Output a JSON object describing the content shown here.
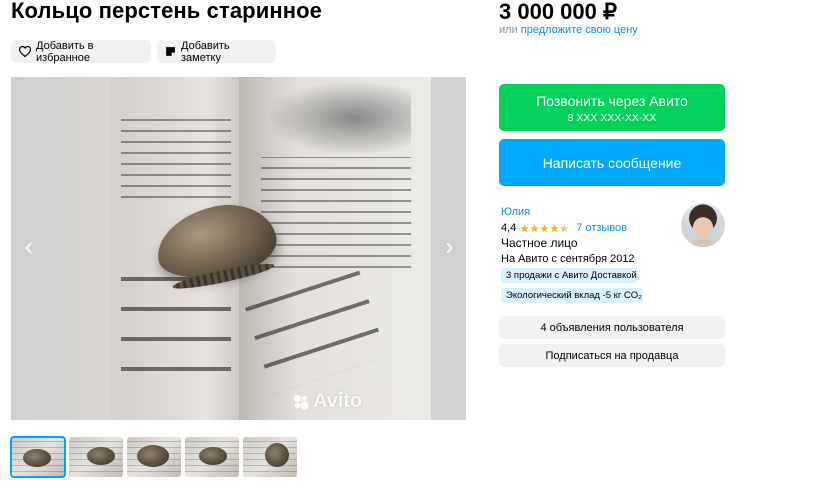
{
  "listing": {
    "title": "Кольцо перстень старинное",
    "actions": {
      "favorite_label": "Добавить в избранное",
      "note_label": "Добавить заметку"
    },
    "gallery": {
      "watermark": "Avito",
      "thumbnails_count": 5,
      "active_index": 0
    }
  },
  "pricing": {
    "price": "3 000 000 ₽",
    "or_label": "или",
    "offer_link": "предложите свою цену"
  },
  "contact": {
    "call_label": "Позвонить через Авито",
    "phone_mask": "8 XXX XXX-XX-XX",
    "message_label": "Написать сообщение"
  },
  "seller": {
    "name": "Юлия",
    "rating": "4,4",
    "rating_value": 4.4,
    "rating_max": 5,
    "reviews": "7 отзывов",
    "type": "Частное лицо",
    "since": "На Авито с сентября 2012",
    "badges": {
      "delivery": "3 продажи с Авито Доставкой",
      "eco": "Экологический вклад -5 кг CO₂"
    },
    "ads_button": "4 объявления пользователя",
    "subscribe_button": "Подписаться на продавца"
  },
  "colors": {
    "call": "#02d15c",
    "message": "#00aaff",
    "link": "#0a8cf0",
    "star": "#ffb021",
    "badge": "#d9f0ff"
  },
  "icons": {
    "favorite": "heart-icon",
    "note": "note-icon",
    "prev": "chevron-left-icon",
    "next": "chevron-right-icon"
  }
}
